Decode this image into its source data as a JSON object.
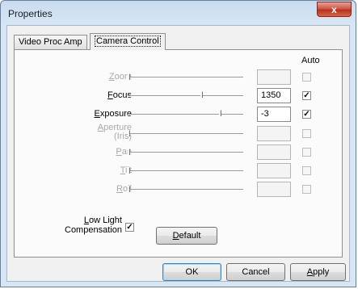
{
  "window": {
    "title": "Properties",
    "close_glyph": "x"
  },
  "tabs": [
    {
      "label": "Video Proc Amp",
      "active": false
    },
    {
      "label": "Camera Control",
      "active": true
    }
  ],
  "auto_header": "Auto",
  "controls": [
    {
      "label": "Zoom",
      "underline": "Z",
      "rest": "oom",
      "enabled": false,
      "value": "",
      "auto": false,
      "slider_pos": 0.0
    },
    {
      "label": "Focus",
      "underline": "F",
      "rest": "ocus",
      "enabled": true,
      "value": "1350",
      "auto": true,
      "slider_pos": 0.63
    },
    {
      "label": "Exposure",
      "underline": "E",
      "rest": "xposure",
      "enabled": true,
      "value": "-3",
      "auto": true,
      "slider_pos": 0.79
    },
    {
      "label_line1": "Aperture",
      "label_line2": "(Iris)",
      "underline": "A",
      "rest": "perture",
      "enabled": false,
      "value": "",
      "auto": false,
      "slider_pos": 0.0
    },
    {
      "label": "Pan",
      "underline": "P",
      "rest": "an",
      "enabled": false,
      "value": "",
      "auto": false,
      "slider_pos": 0.0
    },
    {
      "label": "Tilt",
      "underline": "T",
      "rest": "ilt",
      "enabled": false,
      "value": "",
      "auto": false,
      "slider_pos": 0.0
    },
    {
      "label": "Roll",
      "underline": "R",
      "rest": "oll",
      "enabled": false,
      "value": "",
      "auto": false,
      "slider_pos": 0.0
    }
  ],
  "low_light": {
    "line1_u": "L",
    "line1_rest": "ow Light",
    "line2": "Compensation",
    "checked": true
  },
  "buttons": {
    "default_u": "D",
    "default_rest": "efault",
    "ok": "OK",
    "cancel": "Cancel",
    "apply_u": "A",
    "apply_rest": "pply"
  }
}
